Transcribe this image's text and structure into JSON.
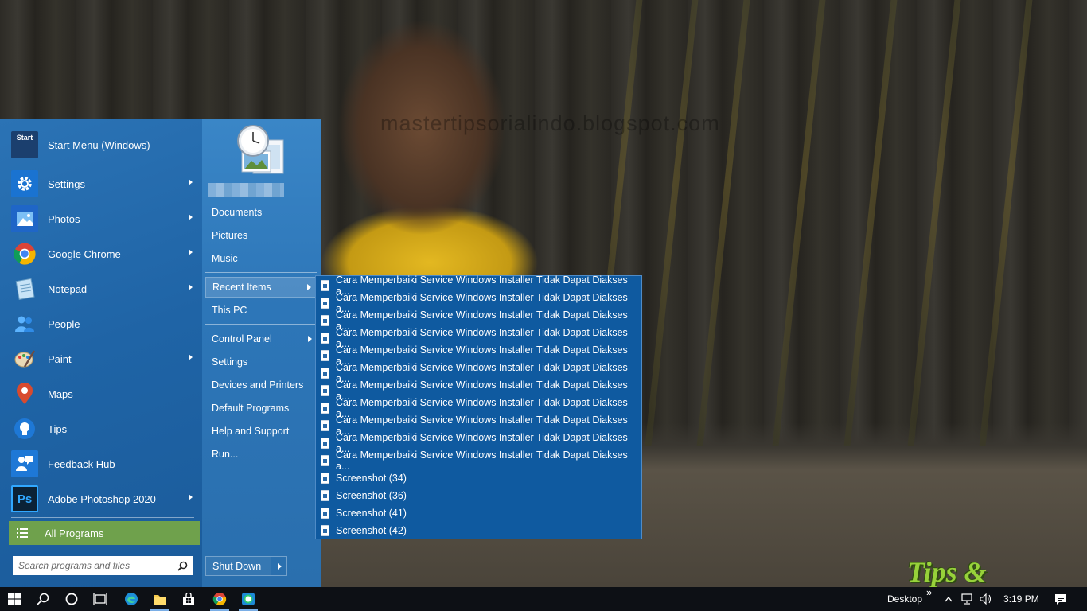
{
  "desktop": {
    "watermark": "mastertipsorialindo.blogspot.com",
    "logo_text": "Tips & Tutorial"
  },
  "start_menu": {
    "pinned": [
      {
        "label": "Start Menu (Windows)",
        "icon": "start-menu-icon",
        "color": "#1b3f6e",
        "has_arrow": false
      },
      {
        "label": "Settings",
        "icon": "gear-icon",
        "color": "#1a73d1",
        "has_arrow": true
      },
      {
        "label": "Photos",
        "icon": "photos-icon",
        "color": "#1f66c7",
        "has_arrow": true
      },
      {
        "label": "Google Chrome",
        "icon": "chrome-icon",
        "color": "#ffffff",
        "has_arrow": true
      },
      {
        "label": "Notepad",
        "icon": "notepad-icon",
        "color": "#9ec7e8",
        "has_arrow": true
      },
      {
        "label": "People",
        "icon": "people-icon",
        "color": "#1e78d6",
        "has_arrow": false
      },
      {
        "label": "Paint",
        "icon": "paint-icon",
        "color": "#d9d9d9",
        "has_arrow": true
      },
      {
        "label": "Maps",
        "icon": "maps-icon",
        "color": "#d23a2a",
        "has_arrow": false
      },
      {
        "label": "Tips",
        "icon": "lightbulb-icon",
        "color": "#1e78d6",
        "has_arrow": false
      },
      {
        "label": "Feedback Hub",
        "icon": "feedback-icon",
        "color": "#1e78d6",
        "has_arrow": false
      },
      {
        "label": "Adobe Photoshop 2020",
        "icon": "photoshop-icon",
        "color": "#0b2236",
        "has_arrow": true
      }
    ],
    "start_icon_text": "Start",
    "photoshop_icon_text": "Ps",
    "all_programs": "All Programs",
    "search_placeholder": "Search programs and files",
    "right_links": {
      "documents": "Documents",
      "pictures": "Pictures",
      "music": "Music",
      "recent_items": "Recent Items",
      "this_pc": "This PC",
      "control_panel": "Control Panel",
      "settings": "Settings",
      "devices_printers": "Devices and Printers",
      "default_programs": "Default Programs",
      "help_support": "Help and Support",
      "run": "Run..."
    },
    "shutdown": "Shut Down"
  },
  "recent_items": [
    "Cara Memperbaiki Service Windows Installer Tidak Dapat Diakses a...",
    "Cara Memperbaiki Service Windows Installer Tidak Dapat Diakses a...",
    "Cara Memperbaiki Service Windows Installer Tidak Dapat Diakses a...",
    "Cara Memperbaiki Service Windows Installer Tidak Dapat Diakses a...",
    "Cara Memperbaiki Service Windows Installer Tidak Dapat Diakses a...",
    "Cara Memperbaiki Service Windows Installer Tidak Dapat Diakses a...",
    "Cara Memperbaiki Service Windows Installer Tidak Dapat Diakses a...",
    "Cara Memperbaiki Service Windows Installer Tidak Dapat Diakses a...",
    "Cara Memperbaiki Service Windows Installer Tidak Dapat Diakses a...",
    "Cara Memperbaiki Service Windows Installer Tidak Dapat Diakses a...",
    "Cara Memperbaiki Service Windows Installer Tidak Dapat Diakses a...",
    "Screenshot (34)",
    "Screenshot (36)",
    "Screenshot (41)",
    "Screenshot (42)"
  ],
  "taskbar": {
    "apps": [
      "windows-start-icon",
      "search-icon",
      "cortana-icon",
      "task-view-icon",
      "edge-icon",
      "file-explorer-icon",
      "store-icon",
      "chrome-icon",
      "whatsapp-icon"
    ],
    "desktop_label": "Desktop",
    "time": "3:19 PM"
  }
}
